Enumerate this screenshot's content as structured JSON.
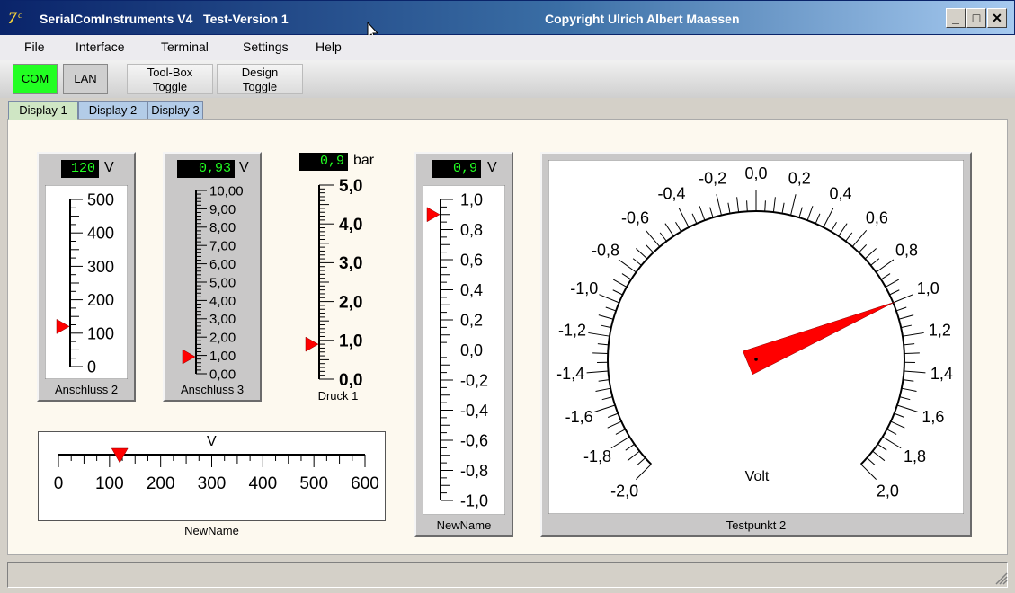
{
  "window": {
    "title": "SerialComInstruments V4   Test-Version 1",
    "copyright": "Copyright Ulrich Albert Maassen",
    "minimize": "_",
    "maximize": "□",
    "close": "✕"
  },
  "menu": [
    "File",
    "Interface",
    "Terminal",
    "Settings",
    "Help"
  ],
  "toolbar": {
    "com": "COM",
    "lan": "LAN",
    "toolbox_line1": "Tool-Box",
    "toolbox_line2": "Toggle",
    "design_line1": "Design",
    "design_line2": "Toggle"
  },
  "tabs": [
    "Display 1",
    "Display 2",
    "Display 3"
  ],
  "colors": {
    "lcd_text": "#22ff22",
    "pointer": "#ff0000",
    "com_active": "#22ff22"
  },
  "instruments": {
    "anschluss2": {
      "value": "120",
      "unit": "V",
      "caption": "Anschluss 2",
      "labels": [
        "500",
        "400",
        "300",
        "200",
        "100",
        "0"
      ],
      "min": 0,
      "max": 500,
      "reading": 120
    },
    "anschluss3": {
      "value": "0,93",
      "unit": "V",
      "caption": "Anschluss 3",
      "labels": [
        "10,00",
        "9,00",
        "8,00",
        "7,00",
        "6,00",
        "5,00",
        "4,00",
        "3,00",
        "2,00",
        "1,00",
        "0,00"
      ],
      "min": 0,
      "max": 10,
      "reading": 0.93
    },
    "druck1": {
      "value": "0,9",
      "unit": "bar",
      "caption": "Druck 1",
      "labels": [
        "5,0",
        "4,0",
        "3,0",
        "2,0",
        "1,0",
        "0,0"
      ],
      "min": 0,
      "max": 5,
      "reading": 0.9
    },
    "newname_h": {
      "unit": "V",
      "caption": "NewName",
      "labels": [
        "0",
        "100",
        "200",
        "300",
        "400",
        "500",
        "600"
      ],
      "min": 0,
      "max": 600,
      "reading": 120
    },
    "newname_v": {
      "value": "0,9",
      "unit": "V",
      "caption": "NewName",
      "labels": [
        "1,0",
        "0,8",
        "0,6",
        "0,4",
        "0,2",
        "0,0",
        "-0,2",
        "-0,4",
        "-0,6",
        "-0,8",
        "-1,0"
      ],
      "min": -1,
      "max": 1,
      "reading": 0.9
    },
    "testpunkt2": {
      "unit": "Volt",
      "caption": "Testpunkt 2",
      "labels": [
        "-2,0",
        "-1,8",
        "-1,6",
        "-1,4",
        "-1,2",
        "-1,0",
        "-0,8",
        "-0,6",
        "-0,4",
        "-0,2",
        "0,0",
        "0,2",
        "0,4",
        "0,6",
        "0,8",
        "1,0",
        "1,2",
        "1,4",
        "1,6",
        "1,8",
        "2,0"
      ],
      "min": -2,
      "max": 2,
      "reading": 1.0
    }
  }
}
